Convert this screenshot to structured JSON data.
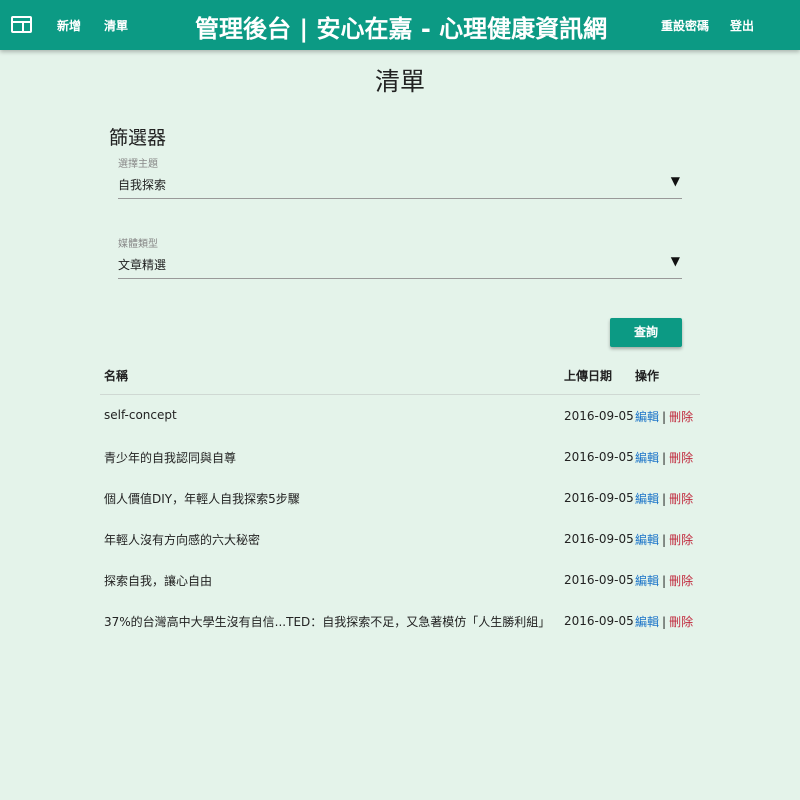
{
  "header": {
    "nav_add": "新增",
    "nav_list": "清單",
    "title": "管理後台 | 安心在嘉 - 心理健康資訊網",
    "reset_password": "重設密碼",
    "logout": "登出",
    "menu_icon": "menu-icon",
    "bar_color": "#0c9a84"
  },
  "page": {
    "title": "清單"
  },
  "filter": {
    "title": "篩選器",
    "topic_label": "選擇主題",
    "topic_value": "自我探索",
    "media_label": "媒體類型",
    "media_value": "文章精選",
    "caret": "▼",
    "query_button": "查詢"
  },
  "table": {
    "headers": {
      "name": "名稱",
      "date": "上傳日期",
      "ops": "操作"
    },
    "edit_label": "編輯",
    "separator": "|",
    "delete_label": "刪除",
    "rows": [
      {
        "name": "self-concept",
        "date": "2016-09-05"
      },
      {
        "name": "青少年的自我認同與自尊",
        "date": "2016-09-05"
      },
      {
        "name": "個人價值DIY，年輕人自我探索5步驟",
        "date": "2016-09-05"
      },
      {
        "name": "年輕人沒有方向感的六大秘密",
        "date": "2016-09-05"
      },
      {
        "name": "探索自我，讓心自由",
        "date": "2016-09-05"
      },
      {
        "name": "37%的台灣高中大學生沒有自信...TED：自我探索不足，又急著模仿「人生勝利組」",
        "date": "2016-09-05"
      }
    ]
  },
  "colors": {
    "accent": "#0c9a84",
    "background": "#e4f3ea",
    "edit_link": "#1a73c8",
    "delete_link": "#c0283c"
  }
}
